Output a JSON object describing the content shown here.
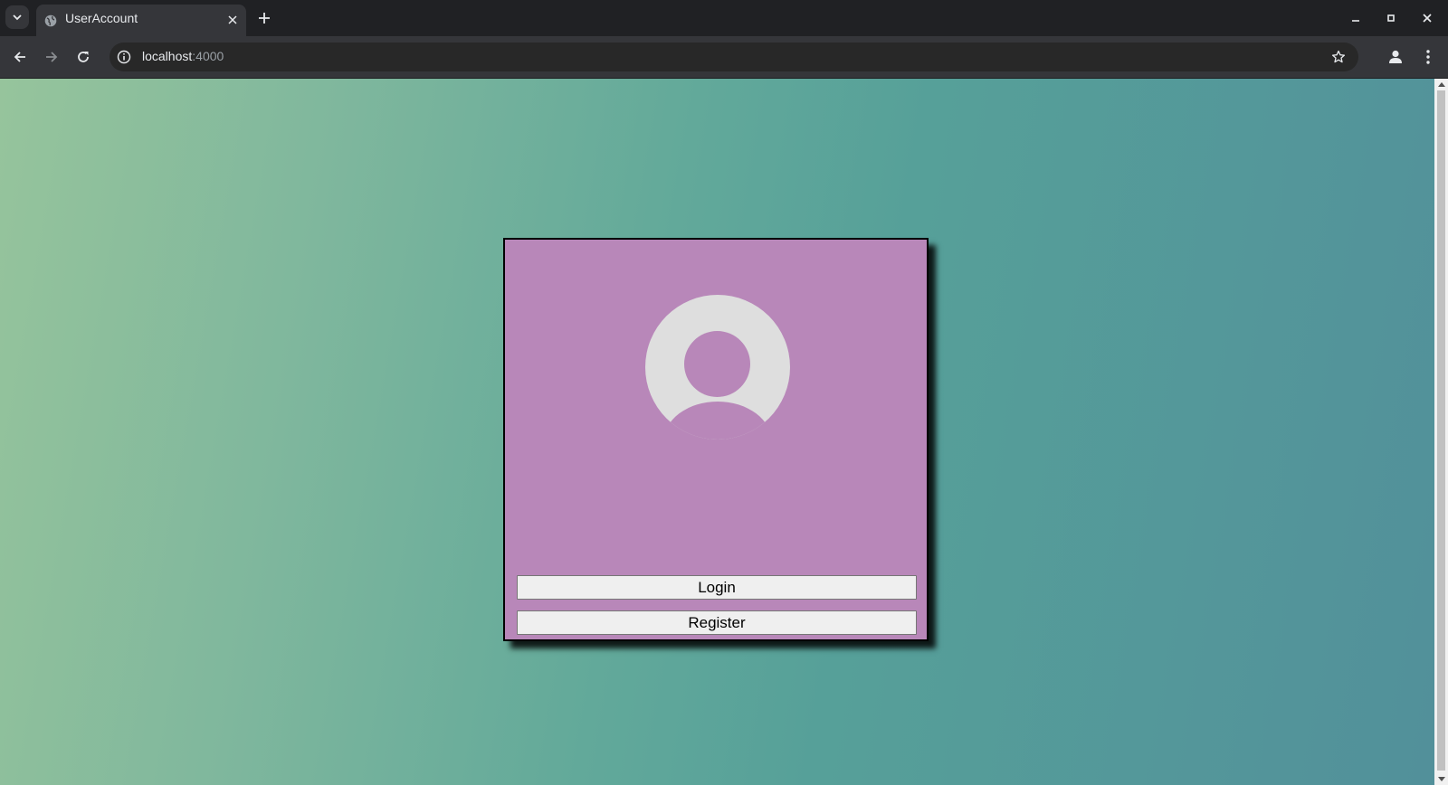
{
  "browser": {
    "tab": {
      "title": "UserAccount"
    },
    "address": {
      "host": "localhost",
      "port": ":4000"
    }
  },
  "card": {
    "avatar_icon": "default-user-avatar-icon",
    "login_label": "Login",
    "register_label": "Register"
  },
  "colors": {
    "page_gradient_start": "#96c49c",
    "page_gradient_end": "#52909a",
    "card_background": "#b887b9",
    "avatar_fill": "#dedede",
    "button_background": "#efefef"
  }
}
